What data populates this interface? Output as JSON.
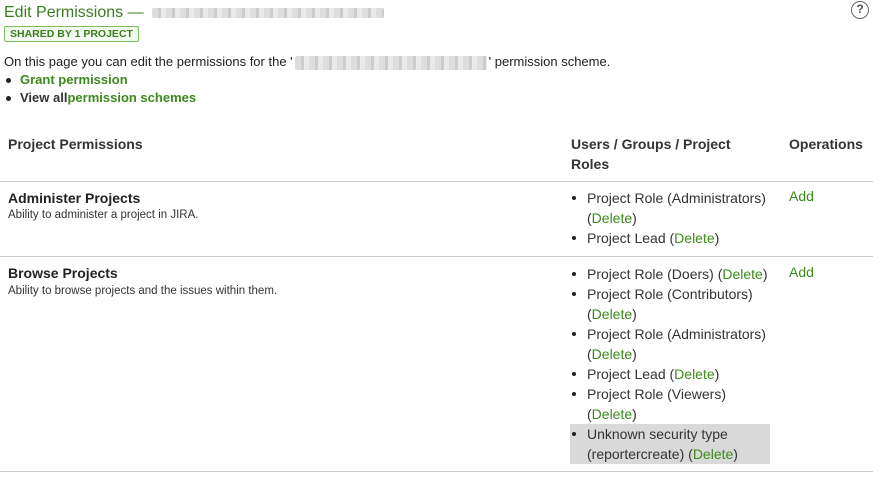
{
  "header": {
    "title": "Edit Permissions —",
    "help_icon": "question-circle-icon"
  },
  "shared_badge": {
    "prefix": "SHARED BY",
    "count": "1",
    "suffix": "PROJECT"
  },
  "intro": {
    "before": "On this page you can edit the permissions for the '",
    "after": "' permission scheme."
  },
  "actions": [
    {
      "prefix": "",
      "link": "Grant permission"
    },
    {
      "prefix": "View all ",
      "link": "permission schemes"
    }
  ],
  "table": {
    "headers": {
      "permissions": "Project Permissions",
      "holders_line1": "Users / Groups / Project",
      "holders_line2": "Roles",
      "operations": "Operations"
    },
    "rows": [
      {
        "name": "Administer Projects",
        "description": "Ability to administer a project in JIRA.",
        "holders": [
          {
            "line1": "Project Role (Administrators)",
            "line2": "(",
            "delete": "Delete",
            "close": ")"
          },
          {
            "line1": "Project Lead (",
            "delete": "Delete",
            "close": ")"
          }
        ],
        "operation": "Add"
      },
      {
        "name": "Browse Projects",
        "description": "Ability to browse projects and the issues within them.",
        "holders": [
          {
            "line1": "Project Role (Doers) (",
            "delete": "Delete",
            "close": ")"
          },
          {
            "line1": "Project Role (Contributors)",
            "line2": "(",
            "delete": "Delete",
            "close": ")"
          },
          {
            "line1": "Project Role (Administrators)",
            "line2": "(",
            "delete": "Delete",
            "close": ")"
          },
          {
            "line1": "Project Lead (",
            "delete": "Delete",
            "close": ")"
          },
          {
            "line1": "Project Role (Viewers)",
            "line2": "(",
            "delete": "Delete",
            "close": ")"
          },
          {
            "line1": "Unknown security type",
            "line2": "(reportercreate) (",
            "delete": "Delete",
            "close": ")"
          }
        ],
        "operation": "Add"
      }
    ]
  },
  "colors": {
    "accent": "#3b8a1c",
    "title": "#3b7e1f",
    "divider": "#cccccc",
    "highlight": "#d9d9d9"
  }
}
